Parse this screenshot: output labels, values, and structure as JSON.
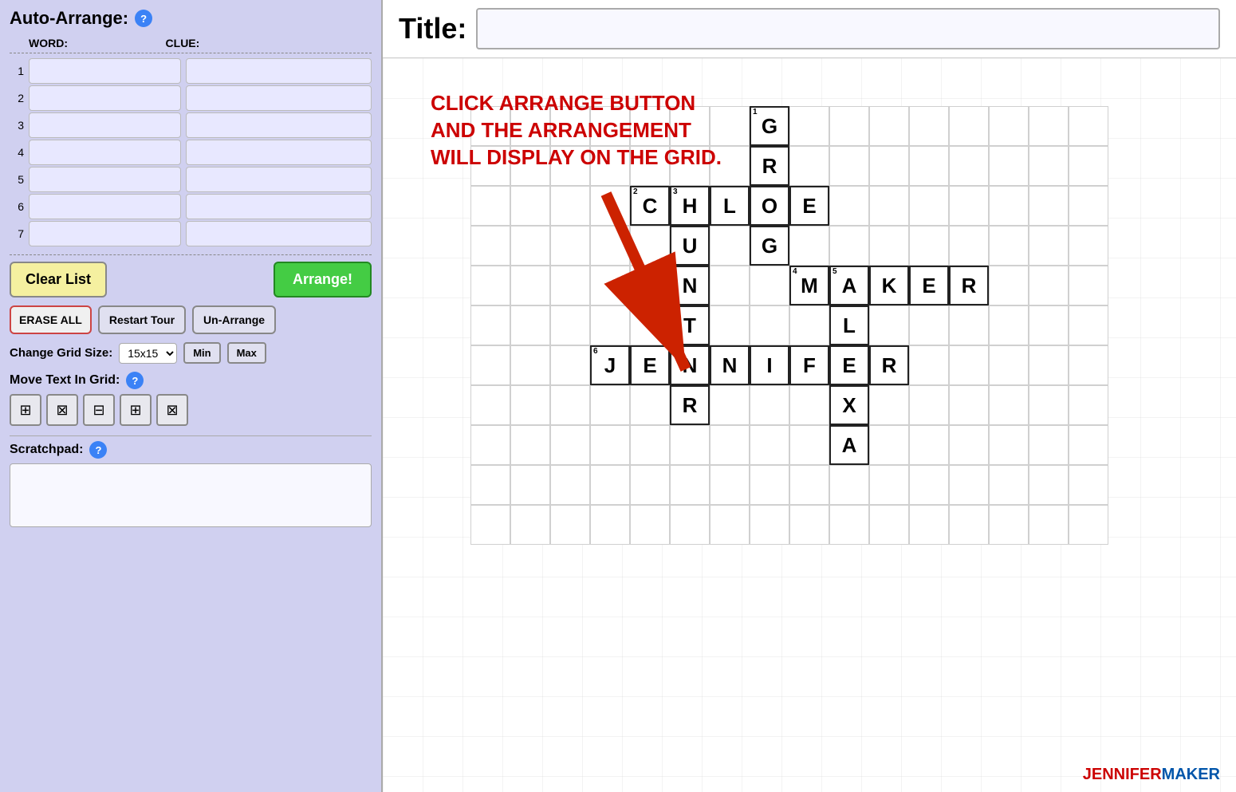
{
  "leftPanel": {
    "autoArrangeLabel": "Auto-Arrange:",
    "wordHeader": "WORD:",
    "clueHeader": "CLUE:",
    "rows": [
      {
        "num": "1"
      },
      {
        "num": "2"
      },
      {
        "num": "3"
      },
      {
        "num": "4"
      },
      {
        "num": "5"
      },
      {
        "num": "6"
      },
      {
        "num": "7"
      }
    ],
    "clearBtn": "Clear List",
    "arrangeBtn": "Arrange!",
    "eraseBtn": "ERASE ALL",
    "restartBtn": "Restart Tour",
    "unarrangeBtn": "Un-Arrange",
    "gridSizeLabel": "Change Grid Size:",
    "gridSizeValue": "15x15",
    "minBtn": "Min",
    "maxBtn": "Max",
    "moveTextLabel": "Move Text In Grid:",
    "scratchpadLabel": "Scratchpad:"
  },
  "rightPanel": {
    "titleLabel": "Title:",
    "titlePlaceholder": "",
    "instructionLine1": "CLICK ARRANGE BUTTON",
    "instructionLine2": "AND THE ARRANGEMENT",
    "instructionLine3": "WILL DISPLAY ON THE GRID."
  },
  "crossword": {
    "gridCols": 20,
    "gridRows": 16,
    "cells": [
      {
        "row": 0,
        "col": 7,
        "letter": "G",
        "number": "1"
      },
      {
        "row": 1,
        "col": 7,
        "letter": "R"
      },
      {
        "row": 2,
        "col": 4,
        "letter": "C",
        "number": "2"
      },
      {
        "row": 2,
        "col": 5,
        "letter": "H",
        "number": "3"
      },
      {
        "row": 2,
        "col": 6,
        "letter": "L"
      },
      {
        "row": 2,
        "col": 7,
        "letter": "O"
      },
      {
        "row": 2,
        "col": 8,
        "letter": "E"
      },
      {
        "row": 3,
        "col": 5,
        "letter": "U"
      },
      {
        "row": 3,
        "col": 7,
        "letter": "G"
      },
      {
        "row": 4,
        "col": 5,
        "letter": "N"
      },
      {
        "row": 4,
        "col": 8,
        "letter": "M",
        "number": "4"
      },
      {
        "row": 4,
        "col": 9,
        "letter": "A",
        "number": "5"
      },
      {
        "row": 4,
        "col": 10,
        "letter": "K"
      },
      {
        "row": 4,
        "col": 11,
        "letter": "E"
      },
      {
        "row": 4,
        "col": 12,
        "letter": "R"
      },
      {
        "row": 5,
        "col": 5,
        "letter": "T"
      },
      {
        "row": 5,
        "col": 9,
        "letter": "L"
      },
      {
        "row": 6,
        "col": 3,
        "letter": "J",
        "number": "6"
      },
      {
        "row": 6,
        "col": 4,
        "letter": "E"
      },
      {
        "row": 6,
        "col": 5,
        "letter": "N"
      },
      {
        "row": 6,
        "col": 6,
        "letter": "N"
      },
      {
        "row": 6,
        "col": 7,
        "letter": "I"
      },
      {
        "row": 6,
        "col": 8,
        "letter": "F"
      },
      {
        "row": 6,
        "col": 9,
        "letter": "E"
      },
      {
        "row": 6,
        "col": 10,
        "letter": "R"
      },
      {
        "row": 7,
        "col": 5,
        "letter": "R"
      },
      {
        "row": 7,
        "col": 9,
        "letter": "X"
      },
      {
        "row": 8,
        "col": 9,
        "letter": "A"
      }
    ]
  },
  "logo": {
    "jennifer": "JENNIFER",
    "maker": "MAKER"
  }
}
